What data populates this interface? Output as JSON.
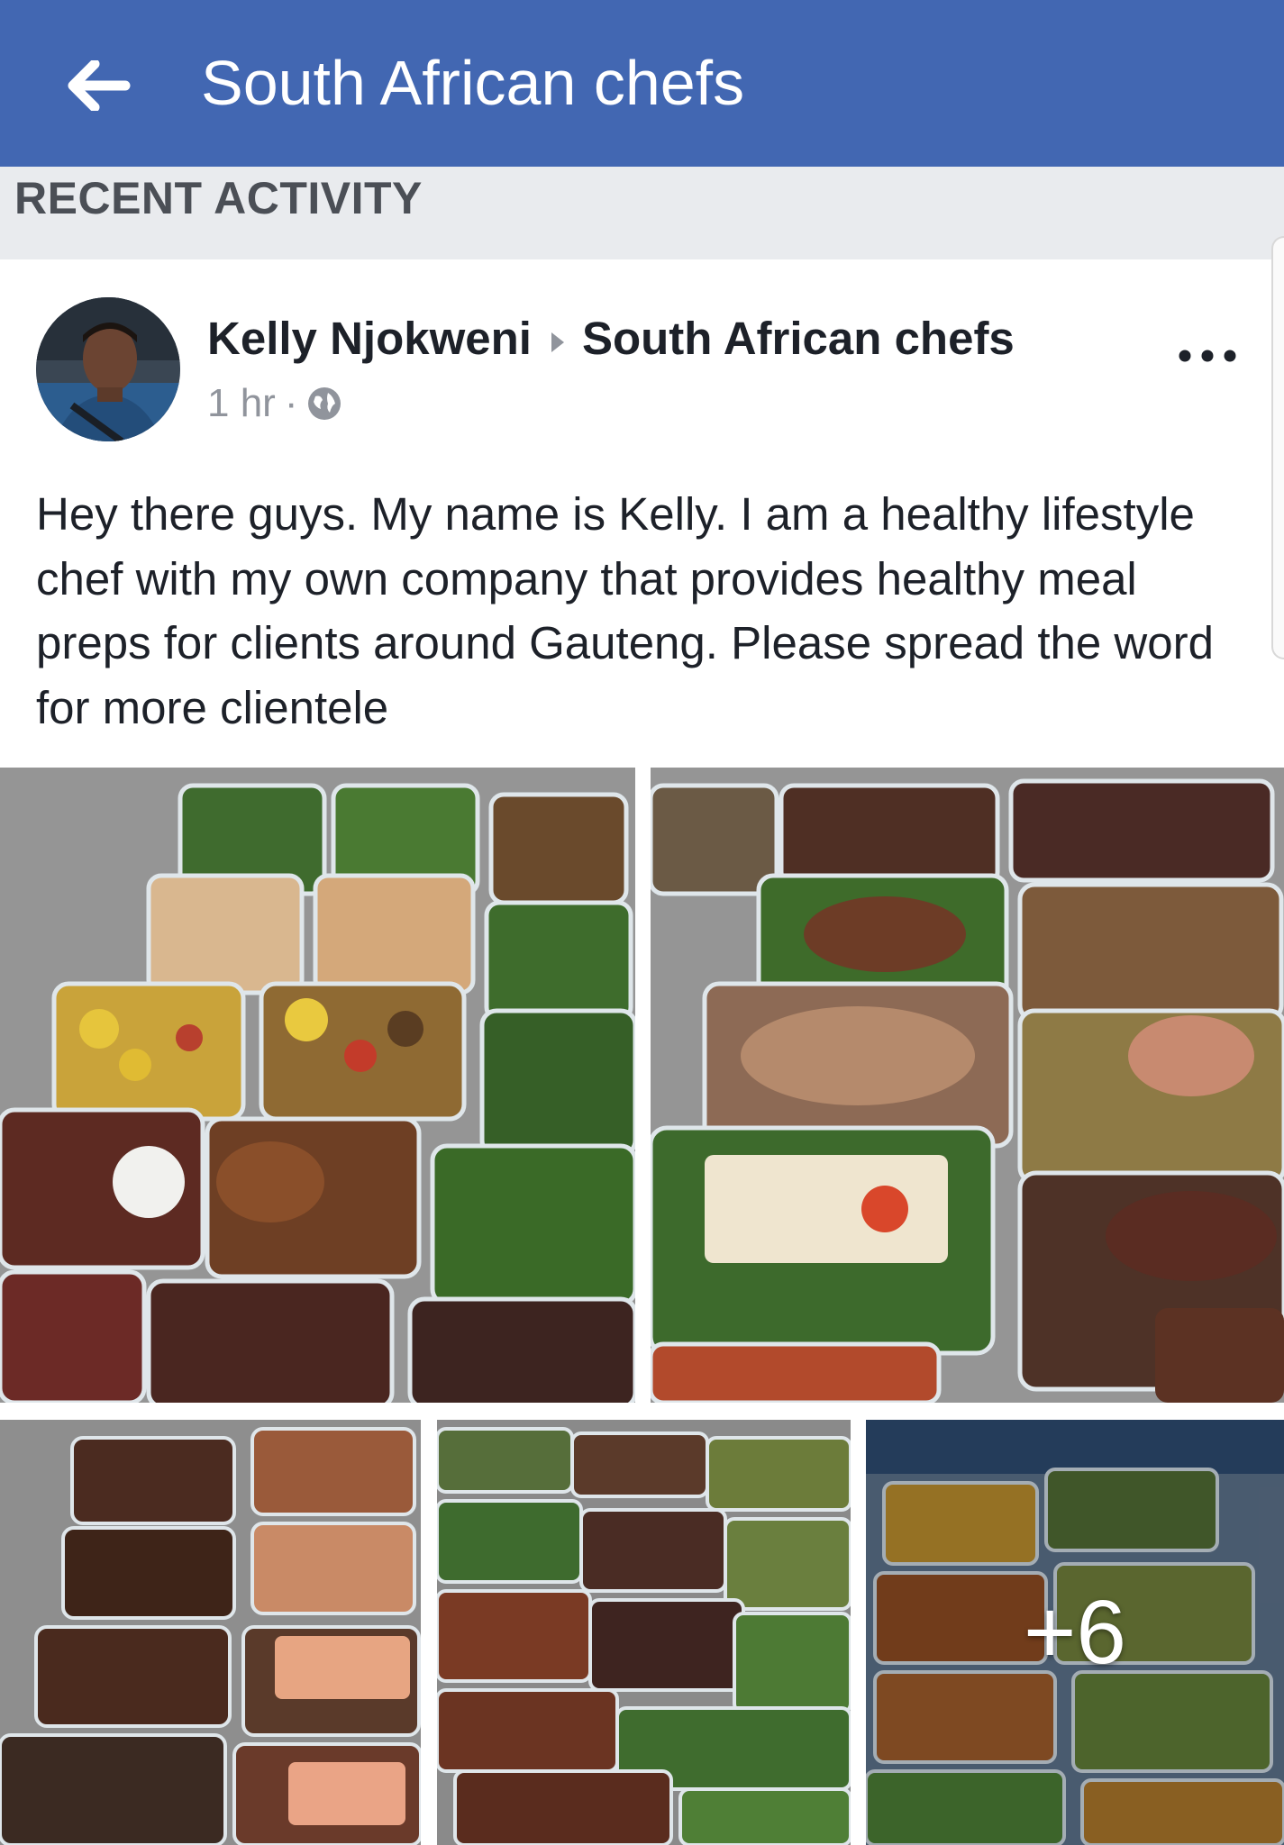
{
  "header": {
    "title": "South African chefs",
    "back_icon": "arrow-left-icon",
    "background_color": "#4267b2"
  },
  "section": {
    "label": "RECENT ACTIVITY"
  },
  "post": {
    "author": "Kelly Njokweni",
    "group": "South African chefs",
    "time": "1 hr",
    "separator": "·",
    "audience_icon": "globe-icon",
    "menu_icon": "more-dots-icon",
    "text": "Hey there guys. My name is Kelly. I am a healthy lifestyle chef with my own company that provides healthy meal preps for clients around Gauteng. Please spread the word for more clientele"
  },
  "photos": {
    "more_count": "+6"
  }
}
